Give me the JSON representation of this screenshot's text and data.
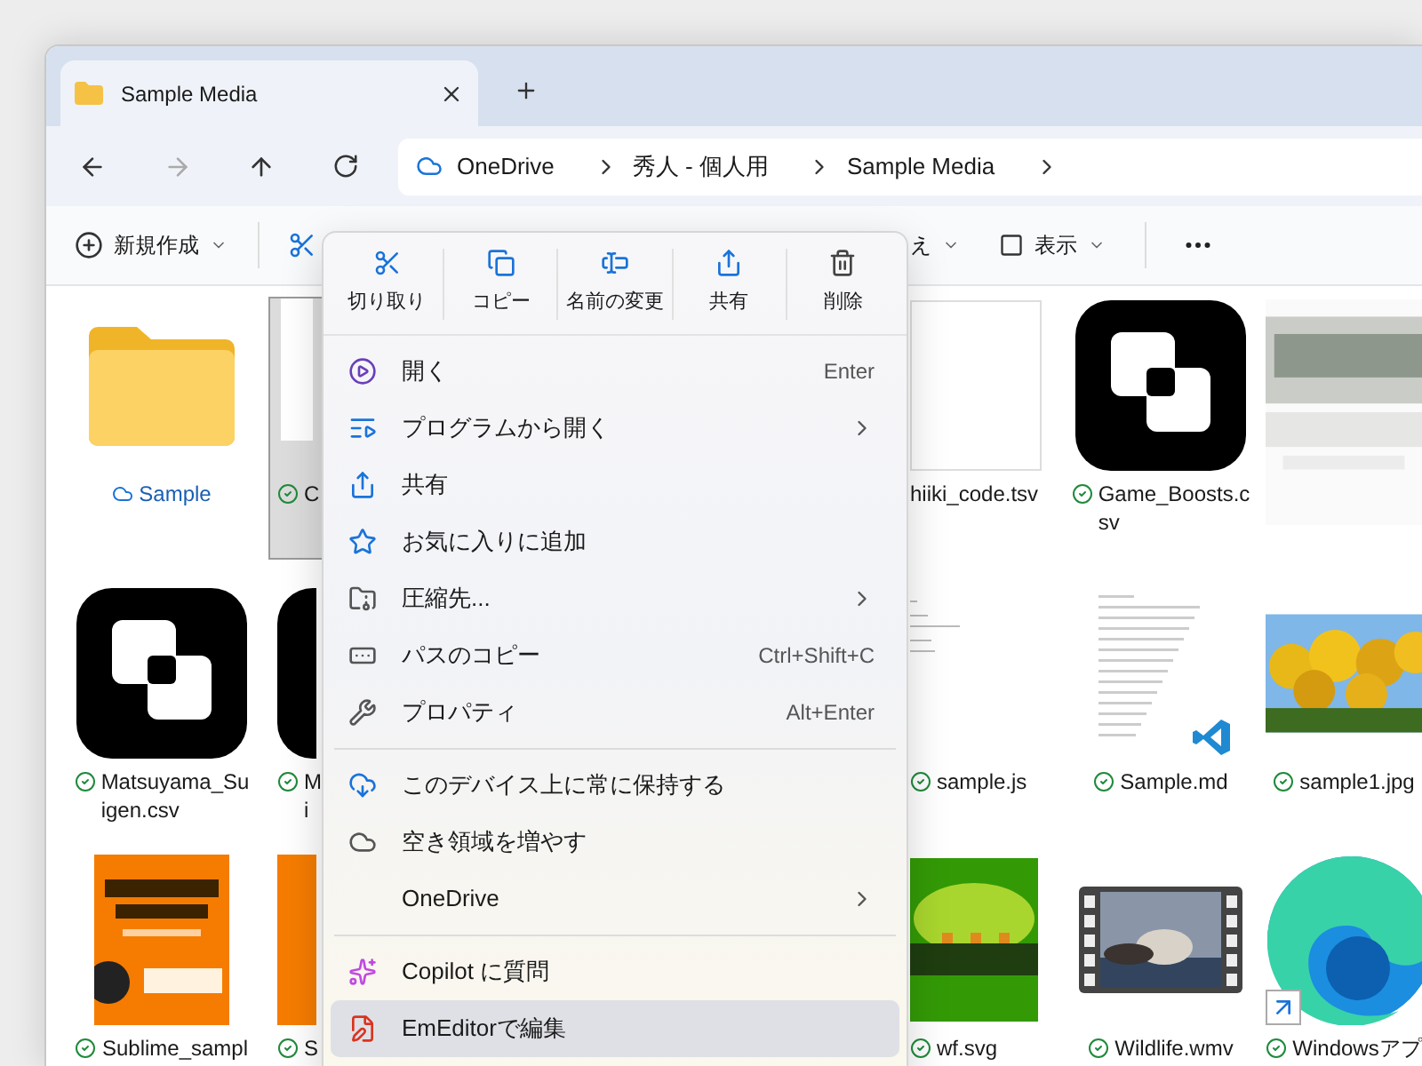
{
  "tab": {
    "title": "Sample Media"
  },
  "breadcrumb": [
    "OneDrive",
    "秀人 - 個人用",
    "Sample Media"
  ],
  "toolbar": {
    "new": "新規作成",
    "sort_fragment": "え",
    "view": "表示"
  },
  "rows": [
    [
      {
        "kind": "folder",
        "label": [
          "Sample"
        ],
        "synced": false,
        "online_only": true,
        "selected": false
      },
      {
        "kind": "blank",
        "label": [
          "C"
        ],
        "synced": true,
        "online_only": false,
        "selected": true
      },
      {
        "kind": "doc",
        "label": [
          "hiiki_code.tsv"
        ],
        "synced": false,
        "online_only": false,
        "selected": false
      },
      {
        "kind": "app",
        "label": [
          "Game_Boosts.c",
          "sv"
        ],
        "synced": true,
        "online_only": false,
        "selected": false
      },
      {
        "kind": "blur",
        "selected": false
      }
    ],
    [
      {
        "kind": "app",
        "label": [
          "Matsuyama_Su",
          "igen.csv"
        ],
        "synced": true,
        "online_only": false,
        "selected": false
      },
      {
        "kind": "app",
        "label": [
          "M",
          "i"
        ],
        "synced": true,
        "online_only": false,
        "selected": false
      },
      {
        "kind": "code",
        "label": [
          "sample.js"
        ],
        "synced": true,
        "online_only": false,
        "selected": false
      },
      {
        "kind": "markdown",
        "label": [
          "Sample.md"
        ],
        "synced": true,
        "online_only": false,
        "selected": false
      },
      {
        "label": [
          "sample1.jpg"
        ],
        "synced": true,
        "online_only": false,
        "selected": false
      }
    ],
    [
      {
        "kind": "book",
        "label": [
          "Sublime_sampl"
        ],
        "synced": true,
        "online_only": false,
        "selected": false
      },
      {
        "kind": "book",
        "label": [
          "S"
        ],
        "synced": true,
        "online_only": false,
        "selected": false
      },
      {
        "kind": "logo",
        "label": [
          "wf.svg"
        ],
        "synced": true,
        "online_only": false,
        "selected": false
      },
      {
        "kind": "video",
        "label": [
          "Wildlife.wmv"
        ],
        "synced": true,
        "online_only": false,
        "selected": false
      },
      {
        "kind": "swirl",
        "label": [
          "Windowsアプ"
        ],
        "synced": true,
        "online_only": false,
        "selected": false
      }
    ]
  ],
  "context_menu": {
    "actions": [
      "切り取り",
      "コピー",
      "名前の変更",
      "共有",
      "削除"
    ],
    "items": [
      {
        "kind": "item",
        "label": "開く",
        "shortcut": "Enter",
        "submenu": false,
        "selected": false
      },
      {
        "kind": "item",
        "label": "プログラムから開く",
        "submenu": true,
        "selected": false
      },
      {
        "kind": "item",
        "label": "共有",
        "submenu": false,
        "selected": false
      },
      {
        "kind": "item",
        "label": "お気に入りに追加",
        "submenu": false,
        "selected": false
      },
      {
        "kind": "item",
        "label": "圧縮先...",
        "submenu": true,
        "selected": false
      },
      {
        "kind": "item",
        "label": "パスのコピー",
        "shortcut": "Ctrl+Shift+C",
        "submenu": false,
        "selected": false
      },
      {
        "kind": "item",
        "label": "プロパティ",
        "shortcut": "Alt+Enter",
        "submenu": false,
        "selected": false
      },
      {
        "kind": "divider"
      },
      {
        "kind": "item",
        "label": "このデバイス上に常に保持する",
        "submenu": false,
        "selected": false
      },
      {
        "kind": "item",
        "label": "空き領域を増やす",
        "submenu": false,
        "selected": false
      },
      {
        "kind": "item",
        "label": "OneDrive",
        "submenu": true,
        "selected": false
      },
      {
        "kind": "divider"
      },
      {
        "kind": "item",
        "label": "Copilot に質問",
        "submenu": false,
        "selected": false
      },
      {
        "kind": "item",
        "label": "EmEditorで編集",
        "submenu": false,
        "selected": true
      }
    ]
  }
}
